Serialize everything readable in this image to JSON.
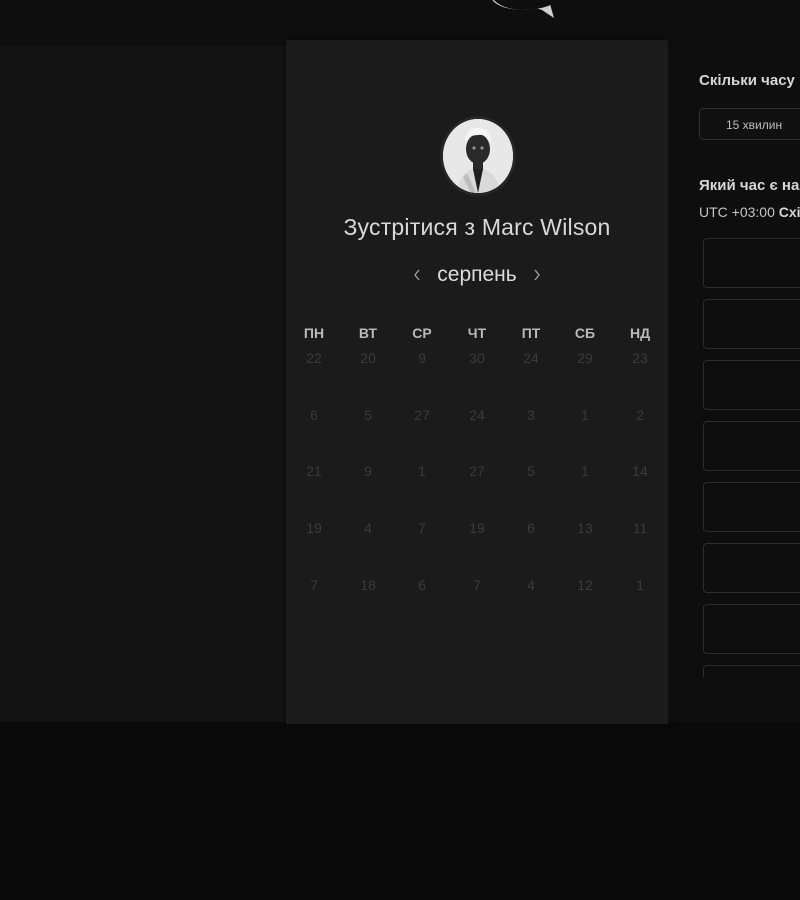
{
  "calendar": {
    "title_prefix": "Зустрітися з",
    "host_name": "Marc Wilson",
    "month": "серпень",
    "weekdays": [
      "ПН",
      "ВТ",
      "СР",
      "ЧТ",
      "ПТ",
      "СБ",
      "НД"
    ],
    "weeks": [
      [
        "22",
        "20",
        "9",
        "30",
        "24",
        "29",
        "23"
      ],
      [
        "6",
        "5",
        "27",
        "24",
        "3",
        "1",
        "2"
      ],
      [
        "21",
        "9",
        "1",
        "27",
        "5",
        "1",
        "14"
      ],
      [
        "19",
        "4",
        "7",
        "19",
        "6",
        "13",
        "11"
      ],
      [
        "7",
        "18",
        "6",
        "7",
        "4",
        "12",
        "1"
      ]
    ]
  },
  "booking": {
    "duration_heading": "Скільки часу",
    "duration_value": "15 хвилин",
    "time_heading": "Який час є на",
    "timezone_prefix": "UTC +03:00",
    "timezone_name": "Схі"
  },
  "icons": {
    "prev": "chevron-left-icon",
    "next": "chevron-right-icon",
    "logo": "chat-logo-icon"
  }
}
